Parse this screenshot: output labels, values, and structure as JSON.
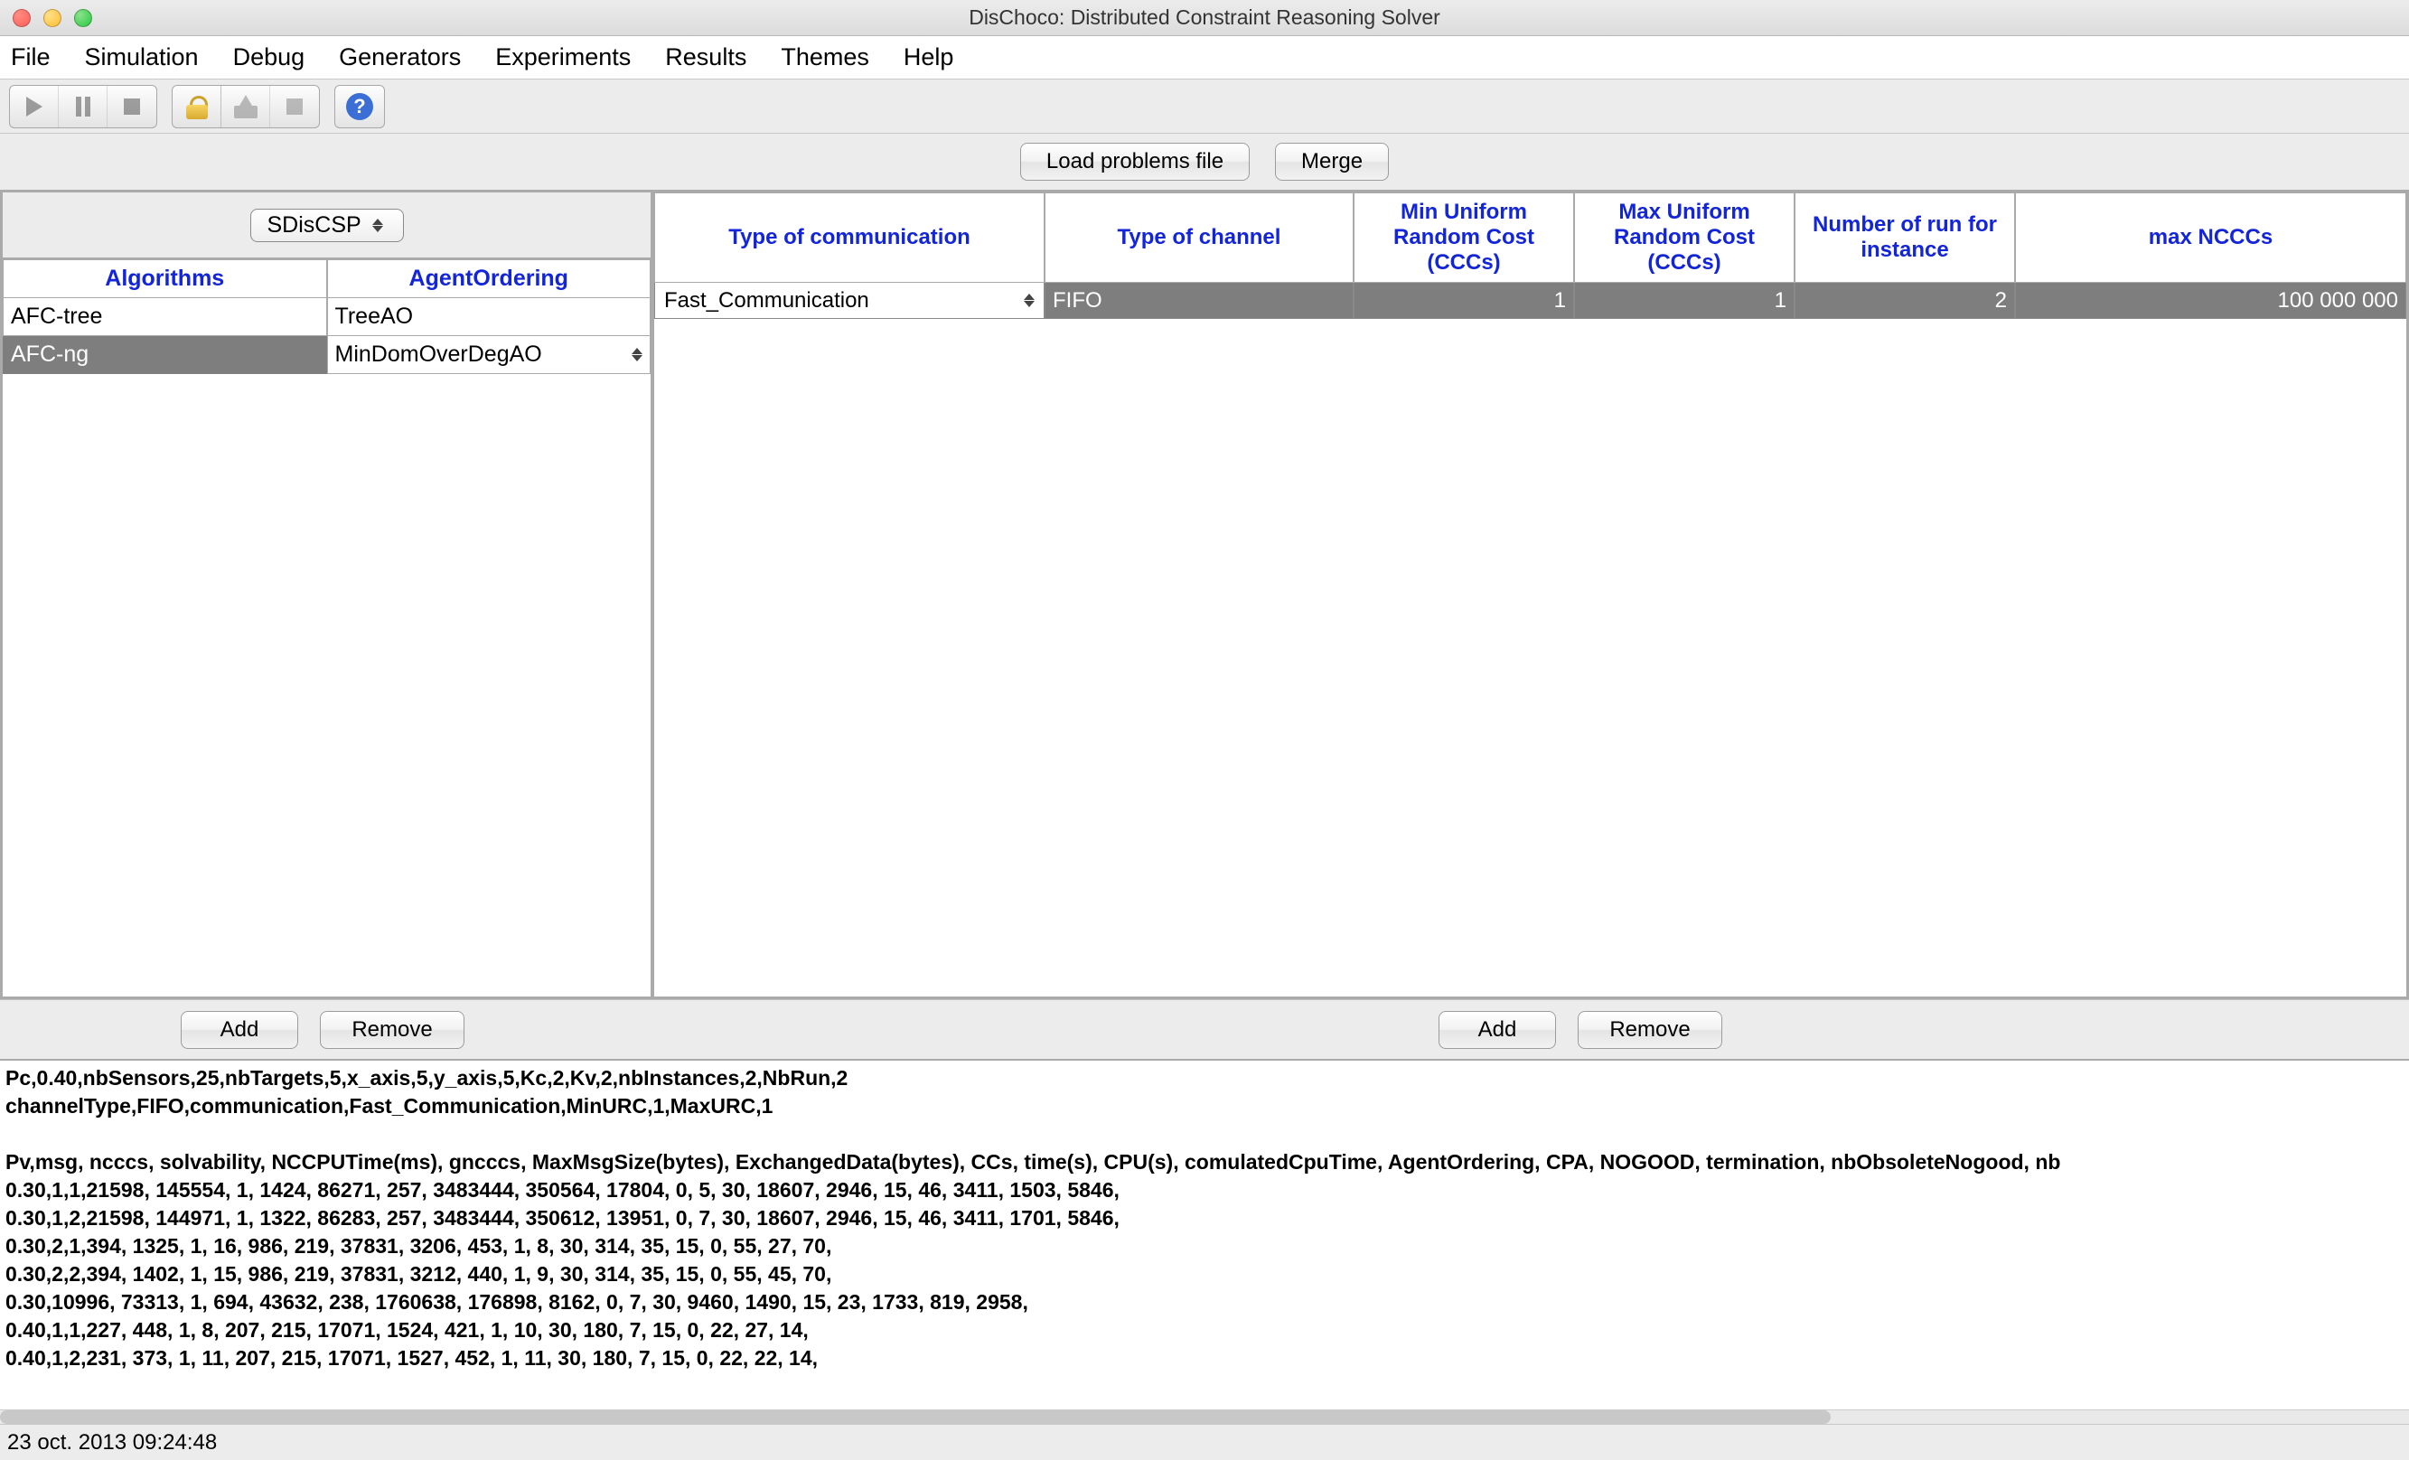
{
  "window": {
    "title": "DisChoco: Distributed Constraint Reasoning Solver"
  },
  "menubar": [
    "File",
    "Simulation",
    "Debug",
    "Generators",
    "Experiments",
    "Results",
    "Themes",
    "Help"
  ],
  "top_buttons": {
    "load": "Load problems file",
    "merge": "Merge"
  },
  "left": {
    "model_select": "SDisCSP",
    "headers": {
      "algorithms": "Algorithms",
      "ordering": "AgentOrdering"
    },
    "rows": [
      {
        "algo": "AFC-tree",
        "ordering": "TreeAO",
        "selected": false,
        "ordering_combo": false
      },
      {
        "algo": "AFC-ng",
        "ordering": "MinDomOverDegAO",
        "selected": true,
        "ordering_combo": true
      }
    ]
  },
  "right": {
    "headers": {
      "comm": "Type of communication",
      "channel": "Type of channel",
      "minurc": "Min Uniform Random Cost (CCCs)",
      "maxurc": "Max Uniform Random Cost (CCCs)",
      "nrun": "Number of run for instance",
      "maxncccs": "max NCCCs"
    },
    "row": {
      "comm": "Fast_Communication",
      "channel": "FIFO",
      "minurc": "1",
      "maxurc": "1",
      "nrun": "2",
      "maxncccs": "100 000 000"
    }
  },
  "mid_buttons": {
    "add": "Add",
    "remove": "Remove"
  },
  "log": "Pc,0.40,nbSensors,25,nbTargets,5,x_axis,5,y_axis,5,Kc,2,Kv,2,nbInstances,2,NbRun,2\nchannelType,FIFO,communication,Fast_Communication,MinURC,1,MaxURC,1\n\nPv,msg, ncccs, solvability, NCCPUTime(ms), gncccs, MaxMsgSize(bytes), ExchangedData(bytes), CCs, time(s), CPU(s), comulatedCpuTime, AgentOrdering, CPA, NOGOOD, termination, nbObsoleteNogood, nb\n0.30,1,1,21598, 145554, 1, 1424, 86271, 257, 3483444, 350564, 17804, 0, 5, 30, 18607, 2946, 15, 46, 3411, 1503, 5846,\n0.30,1,2,21598, 144971, 1, 1322, 86283, 257, 3483444, 350612, 13951, 0, 7, 30, 18607, 2946, 15, 46, 3411, 1701, 5846,\n0.30,2,1,394, 1325, 1, 16, 986, 219, 37831, 3206, 453, 1, 8, 30, 314, 35, 15, 0, 55, 27, 70,\n0.30,2,2,394, 1402, 1, 15, 986, 219, 37831, 3212, 440, 1, 9, 30, 314, 35, 15, 0, 55, 45, 70,\n0.30,10996, 73313, 1, 694, 43632, 238, 1760638, 176898, 8162, 0, 7, 30, 9460, 1490, 15, 23, 1733, 819, 2958,\n0.40,1,1,227, 448, 1, 8, 207, 215, 17071, 1524, 421, 1, 10, 30, 180, 7, 15, 0, 22, 27, 14,\n0.40,1,2,231, 373, 1, 11, 207, 215, 17071, 1527, 452, 1, 11, 30, 180, 7, 15, 0, 22, 22, 14,",
  "status": "23 oct. 2013 09:24:48",
  "icons": {
    "help_glyph": "?"
  }
}
